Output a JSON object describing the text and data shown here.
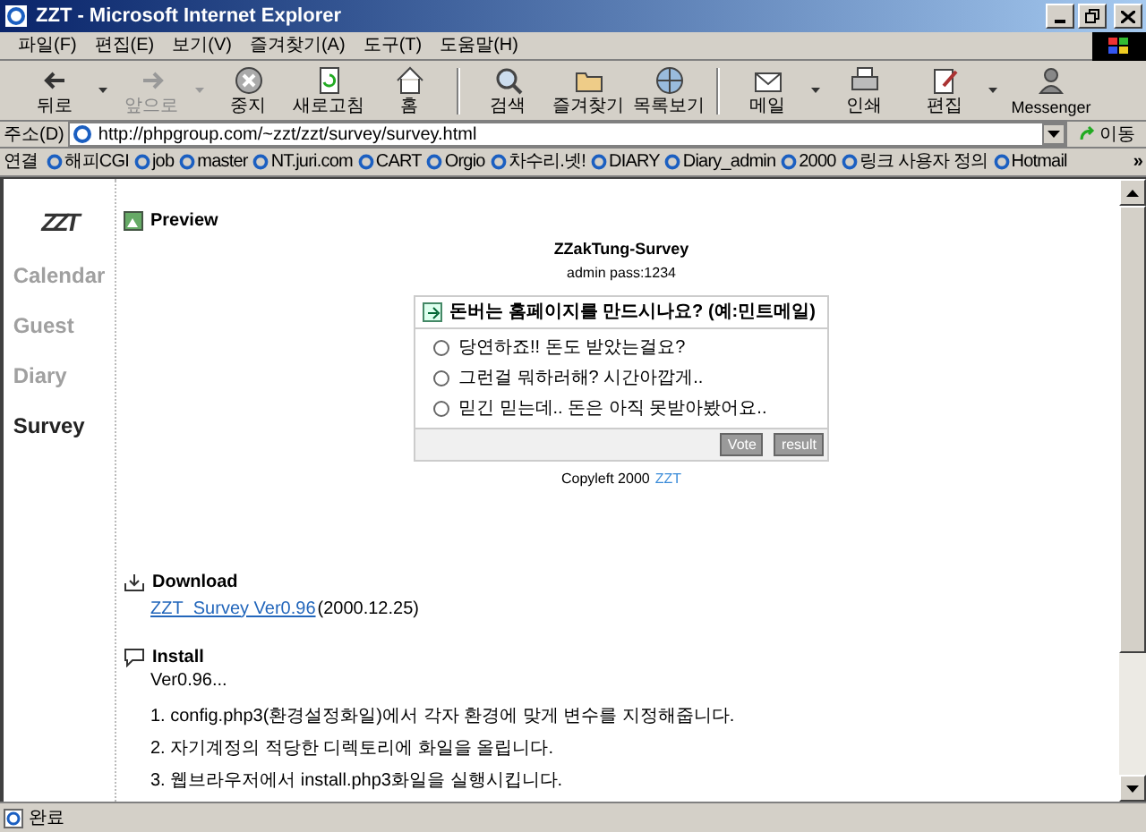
{
  "window": {
    "title": "ZZT - Microsoft Internet Explorer"
  },
  "menu": [
    "파일(F)",
    "편집(E)",
    "보기(V)",
    "즐겨찾기(A)",
    "도구(T)",
    "도움말(H)"
  ],
  "toolbar": [
    {
      "label": "뒤로",
      "disabled": false,
      "dropdown": true
    },
    {
      "label": "앞으로",
      "disabled": true,
      "dropdown": true
    },
    {
      "label": "중지",
      "disabled": false,
      "dropdown": false
    },
    {
      "label": "새로고침",
      "disabled": false,
      "dropdown": false
    },
    {
      "label": "홈",
      "disabled": false,
      "dropdown": false
    },
    {
      "label": "검색",
      "disabled": false,
      "dropdown": false
    },
    {
      "label": "즐겨찾기",
      "disabled": false,
      "dropdown": false
    },
    {
      "label": "목록보기",
      "disabled": false,
      "dropdown": false
    },
    {
      "label": "메일",
      "disabled": false,
      "dropdown": true
    },
    {
      "label": "인쇄",
      "disabled": false,
      "dropdown": false
    },
    {
      "label": "편집",
      "disabled": false,
      "dropdown": true
    },
    {
      "label": "Messenger",
      "disabled": false,
      "dropdown": false
    }
  ],
  "address": {
    "label": "주소(D)",
    "url": "http://phpgroup.com/~zzt/zzt/survey/survey.html",
    "go": "이동"
  },
  "links": {
    "label": "연결",
    "items": [
      "해피CGI",
      "job",
      "master",
      "NT.juri.com",
      "CART",
      "Orgio",
      "차수리.넷!",
      "DIARY",
      "Diary_admin",
      "2000",
      "링크 사용자 정의",
      "Hotmail"
    ],
    "more": "»"
  },
  "sidebar": {
    "logo": "ZZT",
    "items": [
      {
        "label": "Calendar",
        "selected": false
      },
      {
        "label": "Guest",
        "selected": false
      },
      {
        "label": "Diary",
        "selected": false
      },
      {
        "label": "Survey",
        "selected": true
      }
    ]
  },
  "preview": {
    "heading": "Preview",
    "title": "ZZakTung-Survey",
    "subtitle": "admin pass:1234",
    "survey": {
      "question": "돈버는 홈페이지를 만드시나요? (예:민트메일)",
      "options": [
        {
          "label": "당연하죠!! 돈도 받았는걸요?",
          "selected": false
        },
        {
          "label": "그런걸 뭐하러해? 시간아깝게..",
          "selected": false
        },
        {
          "label": "믿긴 믿는데.. 돈은 아직 못받아봤어요..",
          "selected": false
        }
      ],
      "buttons": [
        "Vote",
        "result"
      ]
    },
    "footer": {
      "text": "Copyleft 2000",
      "link": "ZZT"
    }
  },
  "download": {
    "heading": "Download",
    "link": "ZZT_Survey Ver0.96",
    "date": "(2000.12.25)"
  },
  "install": {
    "heading": "Install",
    "lines": [
      "Ver0.96...",
      "1. config.php3(환경설정화일)에서 각자 환경에 맞게 변수를 지정해줍니다.",
      "2. 자기계정의 적당한 디렉토리에 화일을 올립니다.",
      "3. 웹브라우저에서 install.php3화일을 실행시킵니다."
    ]
  },
  "status_bar": {
    "text": "완료"
  }
}
